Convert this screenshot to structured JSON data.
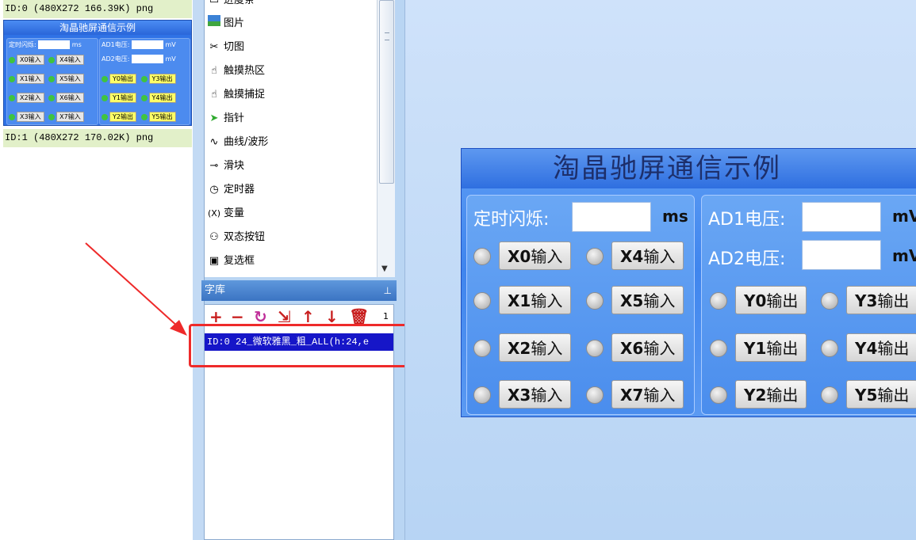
{
  "image_list": {
    "items": [
      {
        "label": "ID:0  (480X272 166.39K) png"
      },
      {
        "label": "ID:1  (480X272 170.02K) png"
      }
    ],
    "thumbnail": {
      "title": "淘晶驰屏通信示例",
      "flash_label": "定时闪烁:",
      "ms": "ms",
      "ad1": "AD1电压:",
      "ad2": "AD2电压:",
      "mv": "mV",
      "x_buttons": [
        "X0输入",
        "X1输入",
        "X2输入",
        "X3输入",
        "X4输入",
        "X5输入",
        "X6输入",
        "X7输入"
      ],
      "y_buttons": [
        "Y0输出",
        "Y1输出",
        "Y2输出",
        "Y3输出",
        "Y4输出",
        "Y5输出"
      ]
    }
  },
  "tools": {
    "items": [
      {
        "label": "进度条",
        "icon": "progress-bar-icon"
      },
      {
        "label": "图片",
        "icon": "picture-icon"
      },
      {
        "label": "切图",
        "icon": "scissors-icon"
      },
      {
        "label": "触摸热区",
        "icon": "hand-icon"
      },
      {
        "label": "触摸捕捉",
        "icon": "hand-icon"
      },
      {
        "label": "指针",
        "icon": "pointer-arrow-icon"
      },
      {
        "label": "曲线/波形",
        "icon": "wave-icon"
      },
      {
        "label": "滑块",
        "icon": "slider-icon"
      },
      {
        "label": "定时器",
        "icon": "clock-icon"
      },
      {
        "label": "变量",
        "icon": "variable-icon"
      },
      {
        "label": "双态按钮",
        "icon": "toggle-button-icon"
      },
      {
        "label": "复选框",
        "icon": "checkbox-icon"
      }
    ]
  },
  "font_library": {
    "header": "字库",
    "count": "1",
    "items": [
      {
        "label": "ID:0  24_微软雅黑_粗_ALL(h:24,e"
      }
    ]
  },
  "screen": {
    "title": "淘晶驰屏通信示例",
    "flash_label": "定时闪烁:",
    "ms_unit": "ms",
    "ad1_label": "AD1电压:",
    "ad2_label": "AD2电压:",
    "mv_unit": "mV",
    "x_buttons": [
      {
        "code": "X0",
        "text": "输入"
      },
      {
        "code": "X1",
        "text": "输入"
      },
      {
        "code": "X2",
        "text": "输入"
      },
      {
        "code": "X3",
        "text": "输入"
      },
      {
        "code": "X4",
        "text": "输入"
      },
      {
        "code": "X5",
        "text": "输入"
      },
      {
        "code": "X6",
        "text": "输入"
      },
      {
        "code": "X7",
        "text": "输入"
      }
    ],
    "y_buttons": [
      {
        "code": "Y0",
        "text": "输出"
      },
      {
        "code": "Y1",
        "text": "输出"
      },
      {
        "code": "Y2",
        "text": "输出"
      },
      {
        "code": "Y3",
        "text": "输出"
      },
      {
        "code": "Y4",
        "text": "输出"
      },
      {
        "code": "Y5",
        "text": "输出"
      }
    ]
  },
  "colors": {
    "selection": "#1616c8",
    "highlight": "#ee2a2a",
    "accent": "#2f72e6"
  }
}
